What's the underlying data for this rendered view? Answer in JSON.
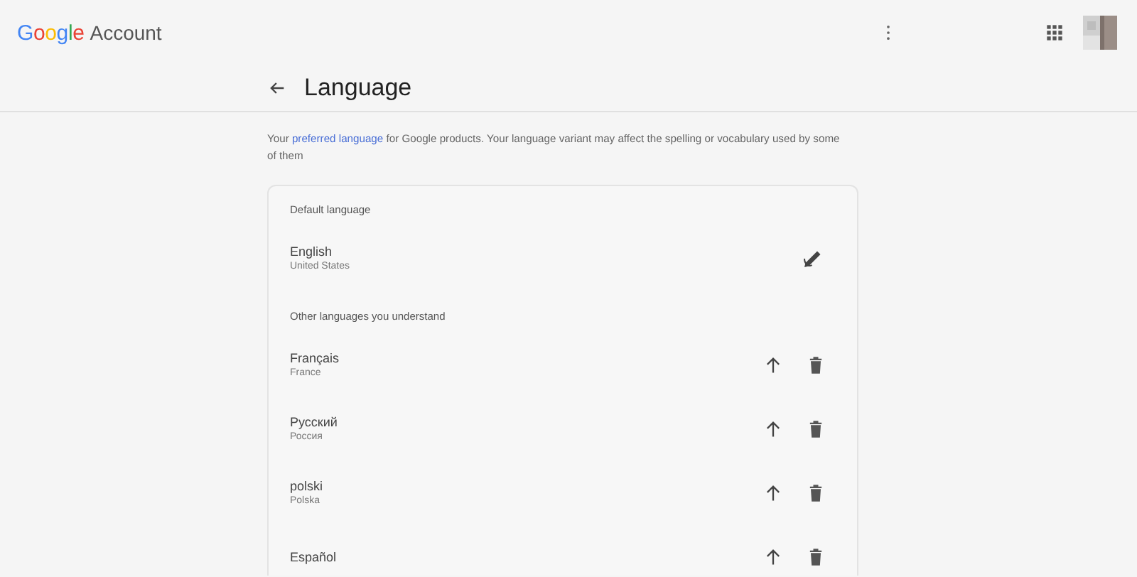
{
  "header": {
    "logo": "Google",
    "product": "Account"
  },
  "page": {
    "title": "Language",
    "description": "Your **preferred language** for Google products. Your language variant may affect the spelling or vocabulary used by some of them"
  },
  "default_section": {
    "heading": "Default language",
    "language": {
      "name": "English",
      "region": "United States"
    }
  },
  "other_section": {
    "heading": "Other languages you understand",
    "languages": [
      {
        "name": "Français",
        "region": "France"
      },
      {
        "name": "Русский",
        "region": "Россия"
      },
      {
        "name": "polski",
        "region": "Polska"
      },
      {
        "name": "Español"
      }
    ]
  }
}
